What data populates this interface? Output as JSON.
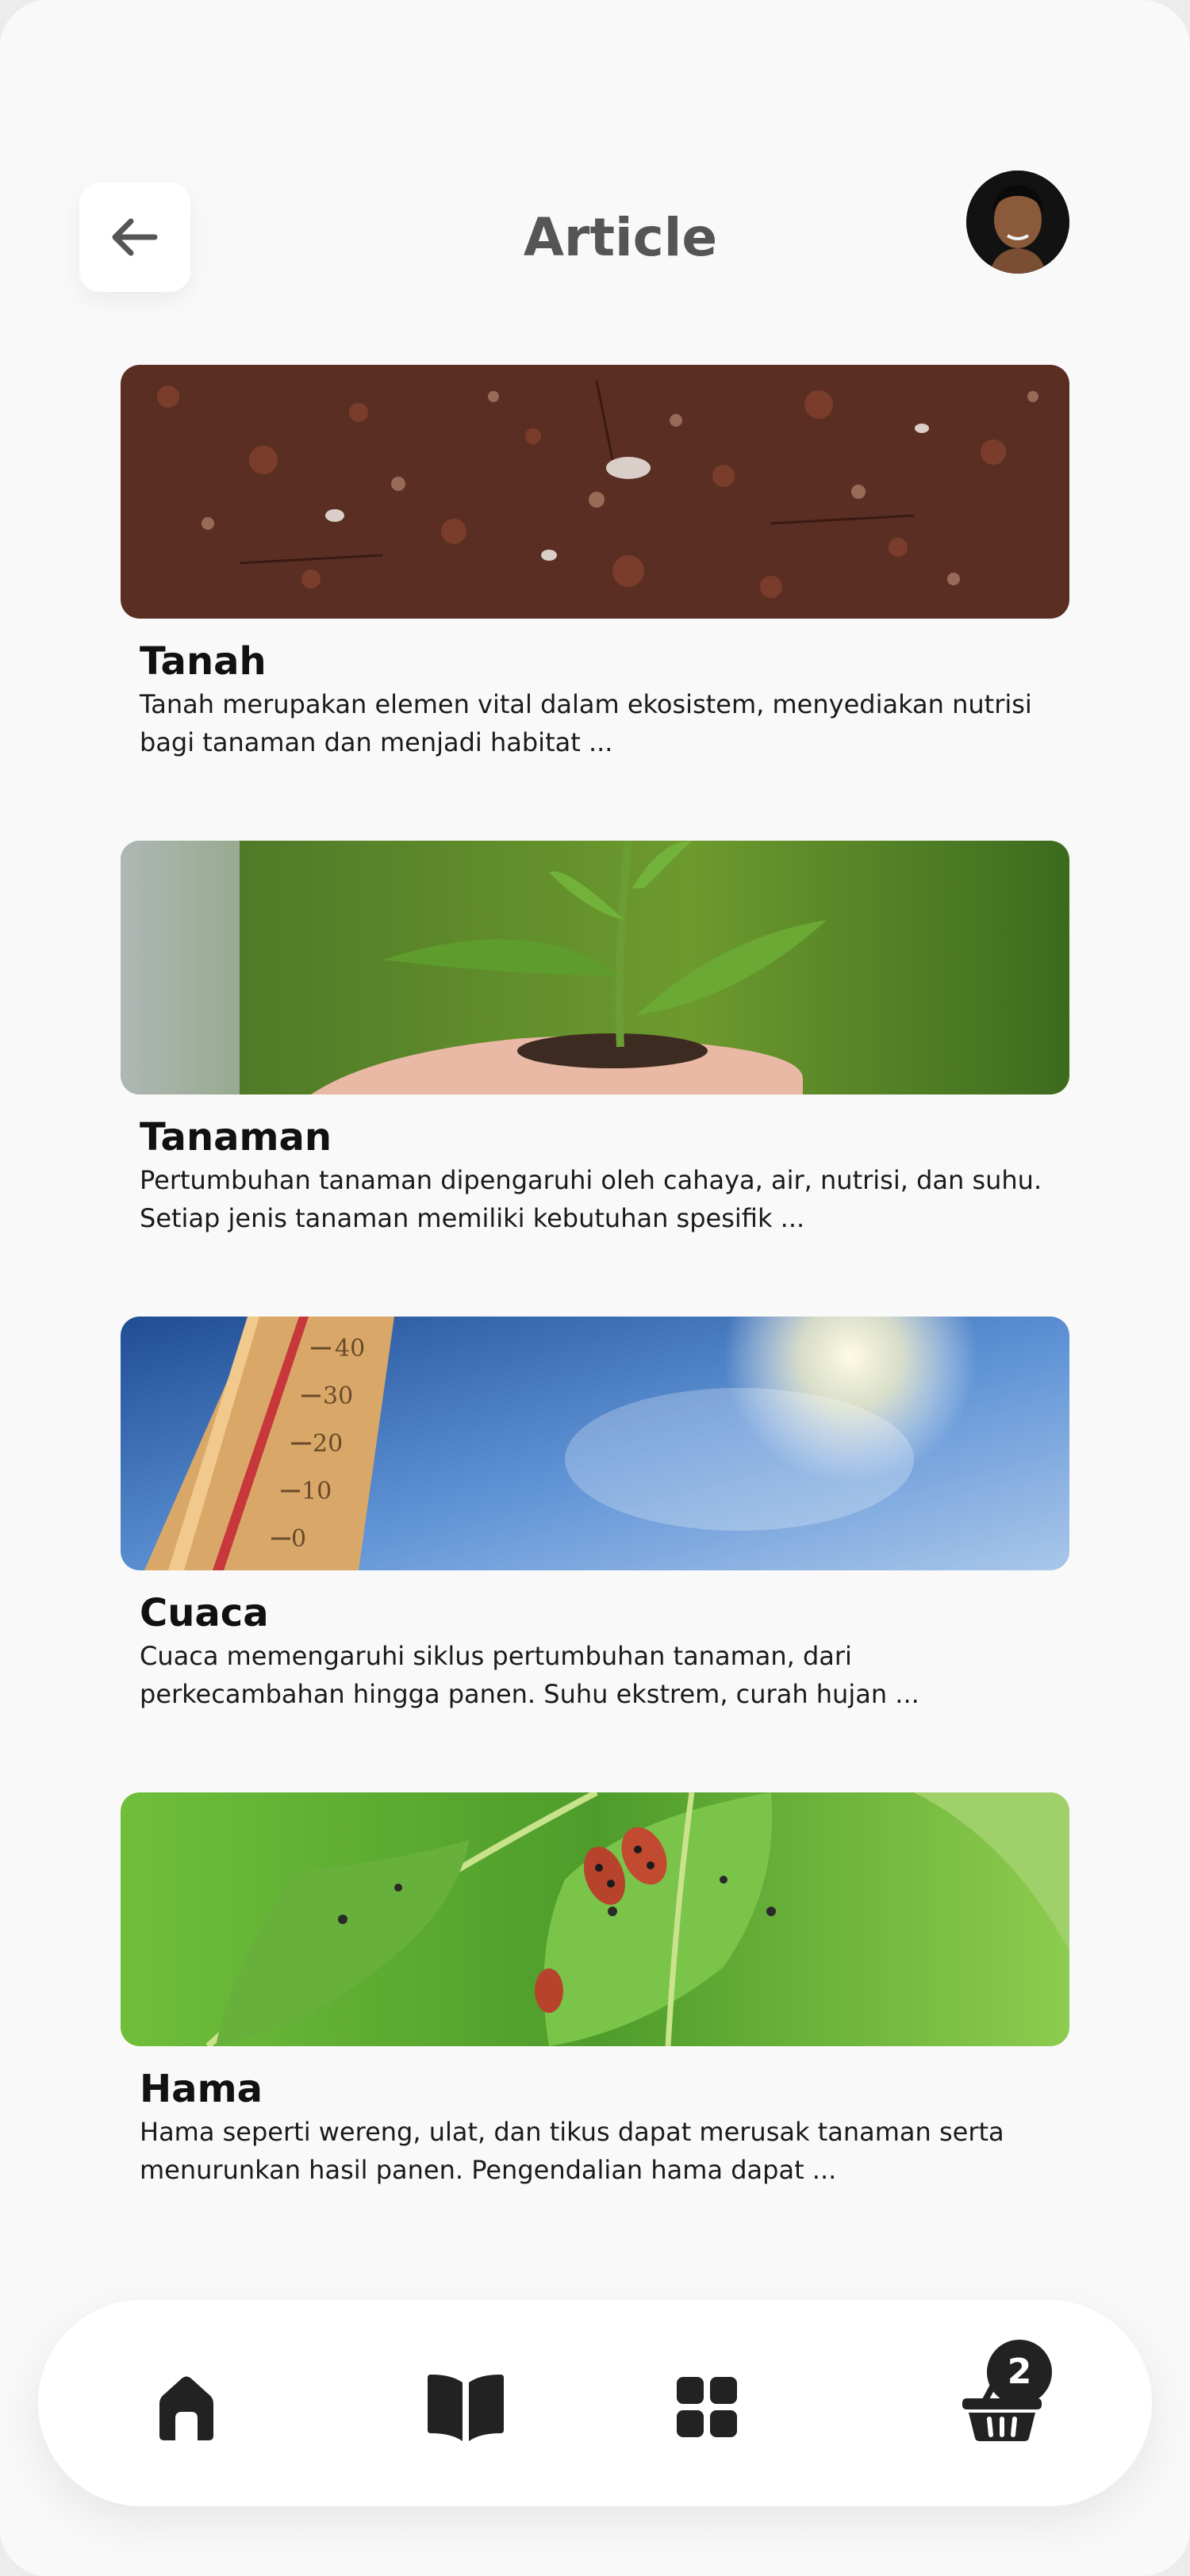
{
  "header": {
    "title": "Article",
    "back_icon": "arrow-left-icon",
    "avatar_icon": "user-avatar"
  },
  "articles": [
    {
      "title": "Tanah",
      "excerpt": "Tanah merupakan elemen vital dalam ekosistem, menyediakan nutrisi bagi tanaman dan menjadi habitat ...",
      "image": "soil-photo"
    },
    {
      "title": "Tanaman",
      "excerpt": "Pertumbuhan tanaman dipengaruhi oleh cahaya, air, nutrisi, dan suhu. Setiap jenis tanaman memiliki kebutuhan spesifik ...",
      "image": "seedling-in-hands-photo"
    },
    {
      "title": "Cuaca",
      "excerpt": "Cuaca memengaruhi siklus pertumbuhan tanaman, dari perkecambahan hingga panen. Suhu ekstrem, curah hujan ...",
      "image": "thermometer-sky-photo"
    },
    {
      "title": "Hama",
      "excerpt": "Hama seperti wereng, ulat, dan tikus dapat merusak tanaman serta menurunkan hasil panen. Pengendalian hama dapat ...",
      "image": "beetles-on-leaf-photo"
    }
  ],
  "bottom_nav": {
    "items": [
      "home-icon",
      "book-icon",
      "grid-icon",
      "basket-icon"
    ],
    "cart_count": "2"
  },
  "colors": {
    "background": "#f9f9f9",
    "title": "#555555",
    "text": "#111111",
    "icon": "#222222"
  }
}
